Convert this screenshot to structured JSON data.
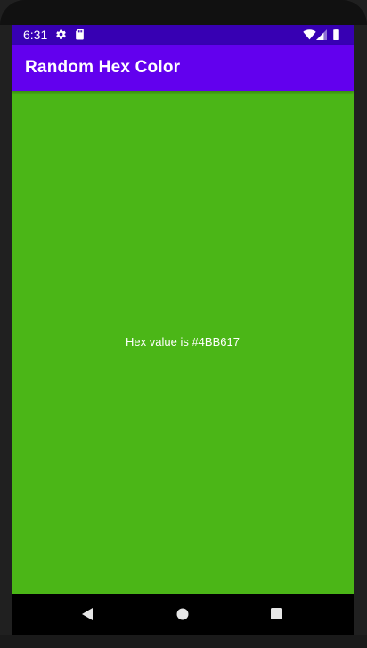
{
  "status_bar": {
    "time": "6:31",
    "icons": [
      "gear-icon",
      "sd-card-icon",
      "wifi-icon",
      "signal-icon",
      "battery-icon"
    ]
  },
  "app_bar": {
    "title": "Random Hex Color",
    "color": "#6200EE"
  },
  "main": {
    "background_color": "#4BB617",
    "hex_label": "Hex value is #4BB617"
  },
  "nav_bar": {
    "buttons": [
      "back-icon",
      "home-icon",
      "recents-icon"
    ]
  },
  "colors": {
    "status_bar": "#3700B3",
    "app_bar": "#6200EE",
    "content": "#4BB617"
  }
}
